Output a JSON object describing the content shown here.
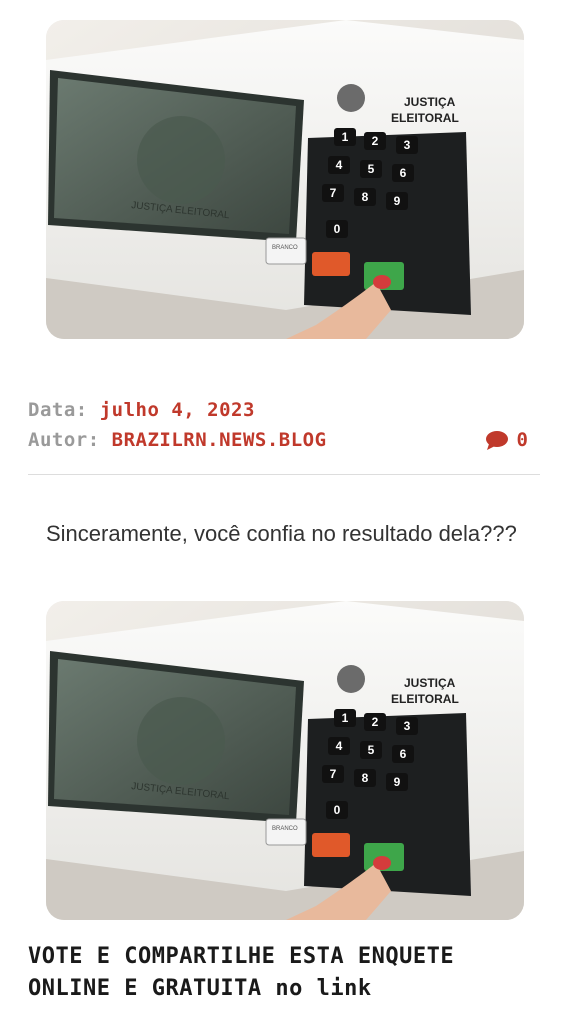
{
  "images": [
    {
      "name": "urna-eletronica-photo",
      "brand_line1": "JUSTIÇA",
      "brand_line2": "ELEITORAL",
      "screen_text": "JUSTIÇA ELEITORAL",
      "keys": [
        "1",
        "2",
        "3",
        "4",
        "5",
        "6",
        "7",
        "8",
        "9",
        "0"
      ],
      "branco": "BRANCO"
    }
  ],
  "post_meta": {
    "date_label": "Data:",
    "date_value": "julho 4, 2023",
    "author_label": "Autor:",
    "author_value": "BRAZILRN.NEWS.BLOG",
    "comment_icon": "comment-bubble-icon",
    "comment_count": "0"
  },
  "intro_text": "Sinceramente, você confia no resultado dela???",
  "cta_text": "VOTE E COMPARTILHE ESTA ENQUETE ONLINE E GRATUITA no link",
  "colors": {
    "accent": "#c0392b",
    "label": "#9a9a9a",
    "text": "#333333"
  }
}
